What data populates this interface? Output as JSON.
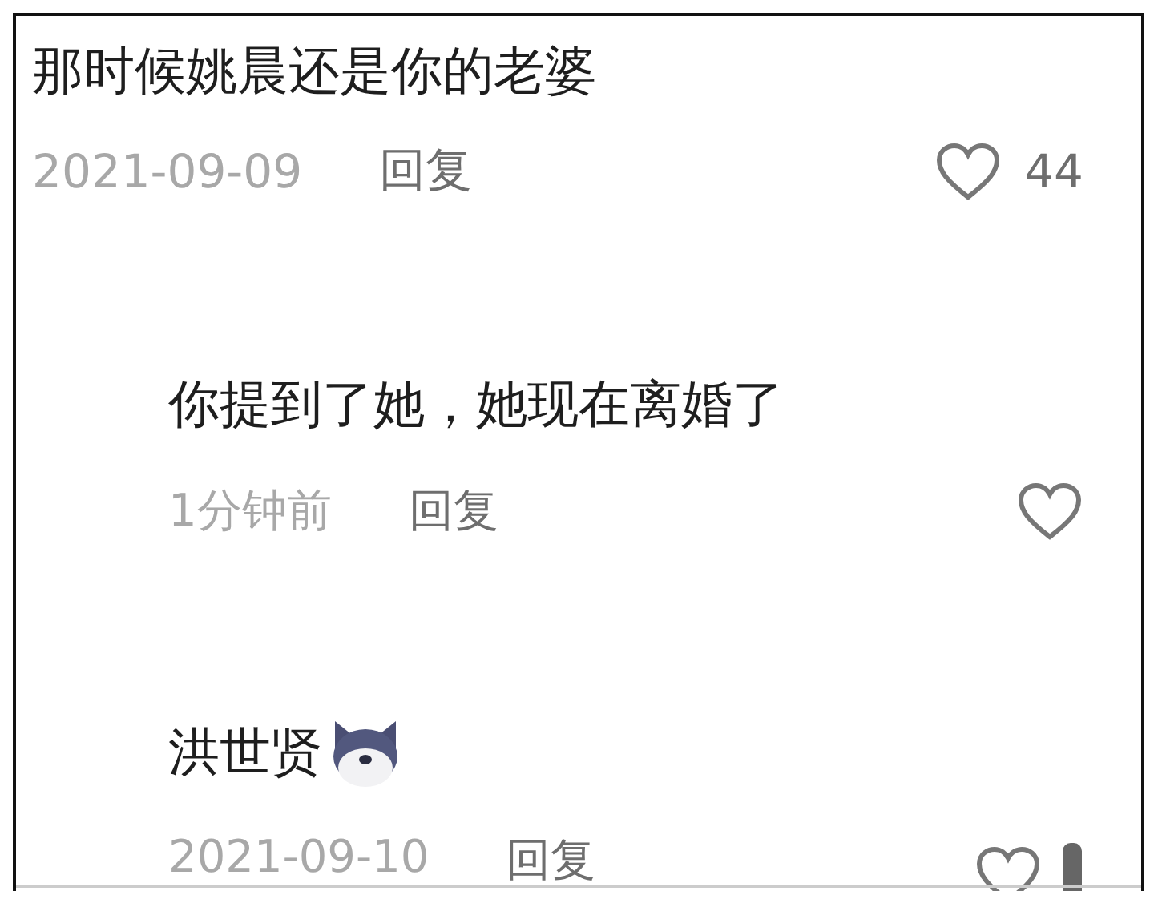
{
  "comment": {
    "text": "那时候姚晨还是你的老婆",
    "date": "2021-09-09",
    "reply_label": "回复",
    "likes": "44",
    "liked": false,
    "replies": [
      {
        "text": "你提到了她，她现在离婚了",
        "date": "1分钟前",
        "reply_label": "回复",
        "liked": false,
        "has_emoji": false,
        "clipped": false
      },
      {
        "text": "洪世贤",
        "date": "2021-09-10",
        "reply_label": "回复",
        "liked": false,
        "has_emoji": true,
        "clipped": true
      }
    ]
  }
}
